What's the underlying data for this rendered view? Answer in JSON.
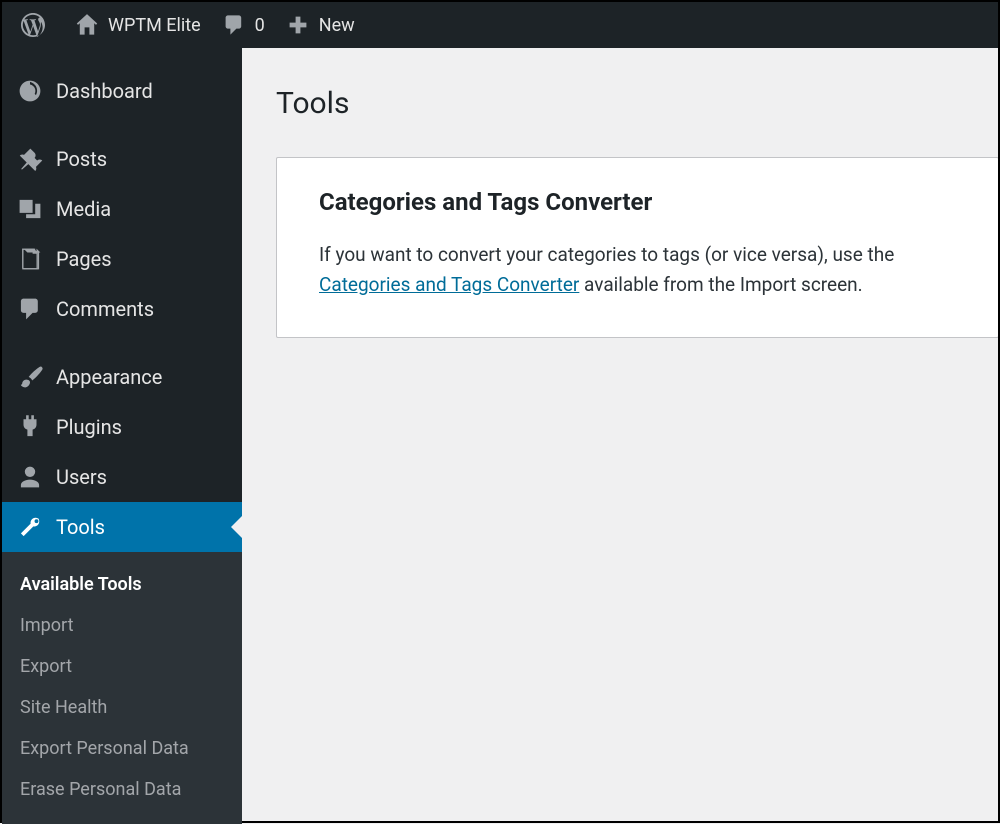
{
  "adminbar": {
    "site_name": "WPTM Elite",
    "comments_count": "0",
    "new_label": "New"
  },
  "sidebar": {
    "items": [
      {
        "label": "Dashboard"
      },
      {
        "label": "Posts"
      },
      {
        "label": "Media"
      },
      {
        "label": "Pages"
      },
      {
        "label": "Comments"
      },
      {
        "label": "Appearance"
      },
      {
        "label": "Plugins"
      },
      {
        "label": "Users"
      },
      {
        "label": "Tools"
      }
    ],
    "submenu": [
      {
        "label": "Available Tools"
      },
      {
        "label": "Import"
      },
      {
        "label": "Export"
      },
      {
        "label": "Site Health"
      },
      {
        "label": "Export Personal Data"
      },
      {
        "label": "Erase Personal Data"
      }
    ]
  },
  "main": {
    "page_title": "Tools",
    "card": {
      "heading": "Categories and Tags Converter",
      "text_before": "If you want to convert your categories to tags (or vice versa), use the ",
      "link_text": "Categories and Tags Converter",
      "text_after": " available from the Import screen."
    }
  }
}
